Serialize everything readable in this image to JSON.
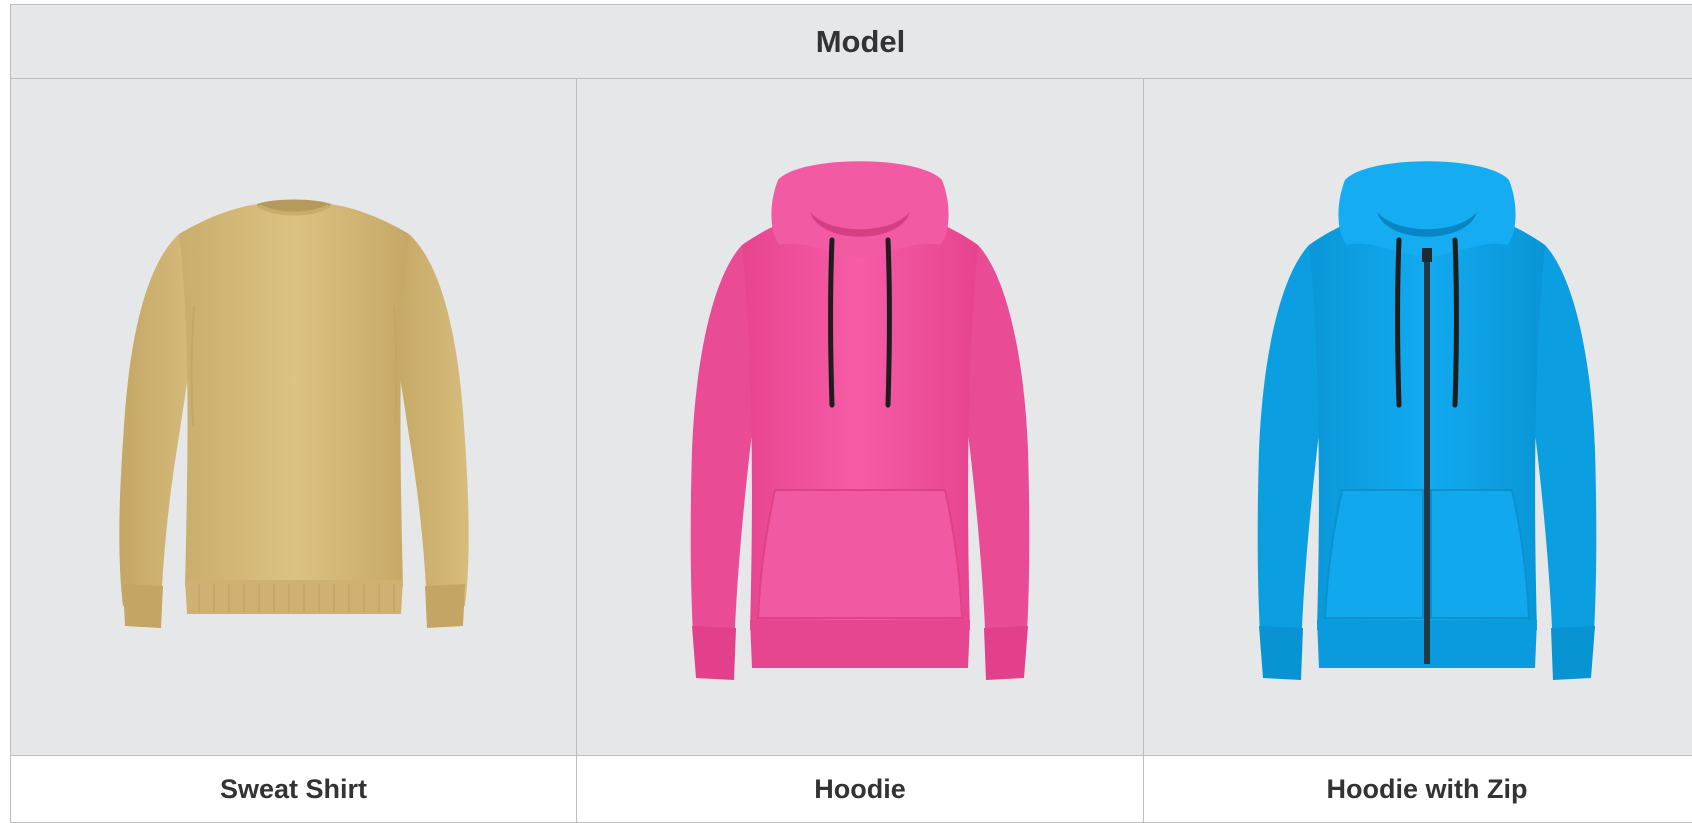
{
  "table": {
    "header": "Model",
    "products": [
      {
        "name": "Sweat Shirt",
        "image": "sweatshirt-image",
        "color": "#d6bc7c"
      },
      {
        "name": "Hoodie",
        "image": "hoodie-image",
        "color": "#f2509e"
      },
      {
        "name": "Hoodie with Zip",
        "image": "zip-hoodie-image",
        "color": "#0aa6ea"
      }
    ]
  }
}
